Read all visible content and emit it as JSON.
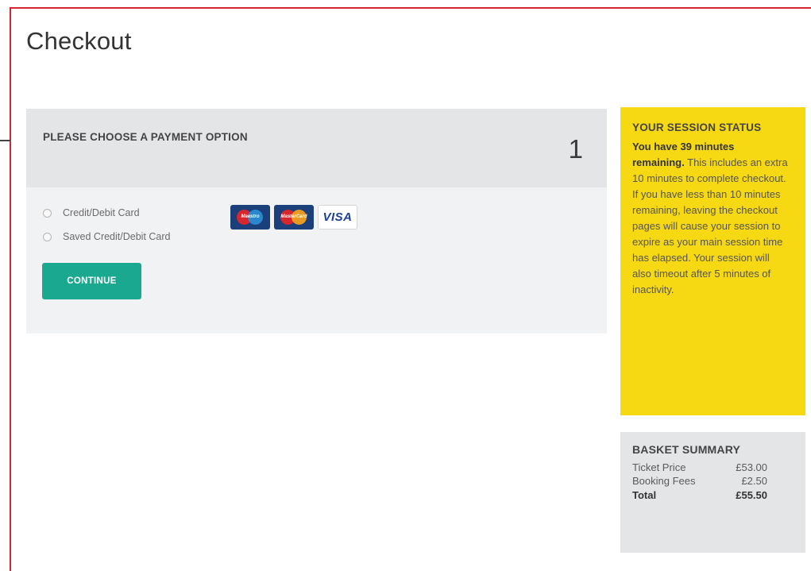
{
  "page": {
    "title": "Checkout"
  },
  "payment": {
    "heading": "PLEASE CHOOSE A PAYMENT OPTION",
    "step": "1",
    "options": [
      {
        "label": "Credit/Debit Card"
      },
      {
        "label": "Saved Credit/Debit Card"
      }
    ],
    "cards": {
      "maestro": "Maestro",
      "mastercard": "MasterCard",
      "visa": "VISA"
    },
    "continue_label": "CONTINUE"
  },
  "session": {
    "title": "YOUR SESSION STATUS",
    "bold_text": "You have 39 minutes remaining.",
    "body_text": " This includes an extra 10 minutes to complete checkout. If you have less than 10 minutes remaining, leaving the checkout pages will cause your session to expire as your main session time has elapsed. Your session will also timeout after 5 minutes of inactivity."
  },
  "basket": {
    "title": "BASKET SUMMARY",
    "rows": [
      {
        "label": "Ticket Price",
        "amount": "£53.00"
      },
      {
        "label": "Booking Fees",
        "amount": "£2.50"
      }
    ],
    "total": {
      "label": "Total",
      "amount": "£55.50"
    }
  },
  "colors": {
    "frame": "#d7262e",
    "continue_button": "#1aa891",
    "session_box": "#f7d913",
    "panel_header": "#e4e5e7",
    "panel_body": "#f1f2f4"
  }
}
